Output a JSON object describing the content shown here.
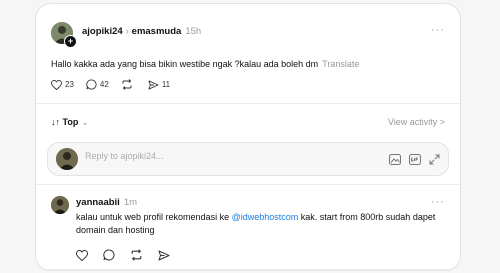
{
  "post": {
    "author": "ajopiki24",
    "reply_to": "emasmuda",
    "time": "15h",
    "text": "Hallo kakka ada yang bisa bikin westibe ngak ?kalau ada boleh dm",
    "translate": "Translate",
    "likes": "23",
    "comments": "42",
    "shares": "11",
    "more": "···",
    "follow_badge": "+"
  },
  "sort": {
    "label": "Top",
    "arrows": "↓↑"
  },
  "view_activity": "View activity >",
  "reply_box": {
    "placeholder": "Reply to ajopiki24..."
  },
  "reply": {
    "author": "yannaabii",
    "time": "1m",
    "more": "···",
    "text_before": "kalau untuk web profil rekomendasi ke ",
    "mention": "@idwebhostcom",
    "text_after": " kak. start from 800rb sudah dapet domain dan hosting"
  },
  "colors": {
    "link": "#1d7ce4",
    "muted": "#999999"
  }
}
